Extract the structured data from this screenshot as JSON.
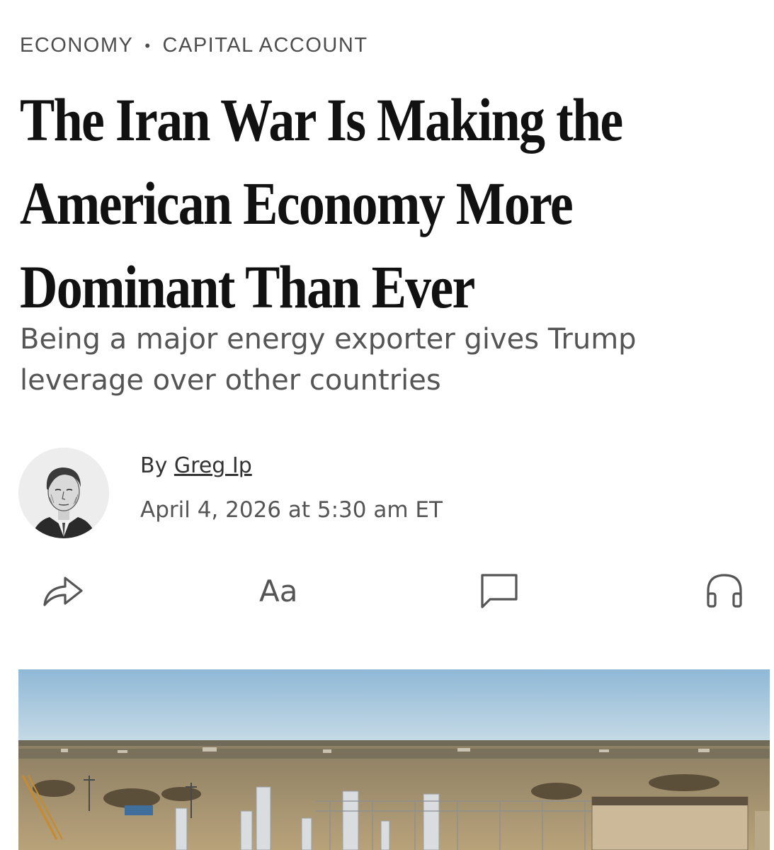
{
  "section": {
    "primary": "ECONOMY",
    "separator": "•",
    "secondary": "CAPITAL ACCOUNT"
  },
  "headline": {
    "lines": [
      "The Iran War Is Making the",
      "American Economy More",
      "Dominant Than Ever"
    ]
  },
  "dek": {
    "lines": [
      "Being a major energy exporter gives Trump",
      "leverage over other countries"
    ]
  },
  "byline": {
    "prefix": "By",
    "author": "Greg Ip",
    "timestamp": "April 4, 2026 at 5:30 am ET"
  },
  "toolbar": {
    "share_icon": "share-icon",
    "text_size_label": "Aa",
    "comments_icon": "comment-icon",
    "listen_icon": "headphones-icon"
  },
  "colors": {
    "headline": "#111111",
    "section": "#4d4d4d",
    "dek": "#555555",
    "icon": "#555555"
  }
}
